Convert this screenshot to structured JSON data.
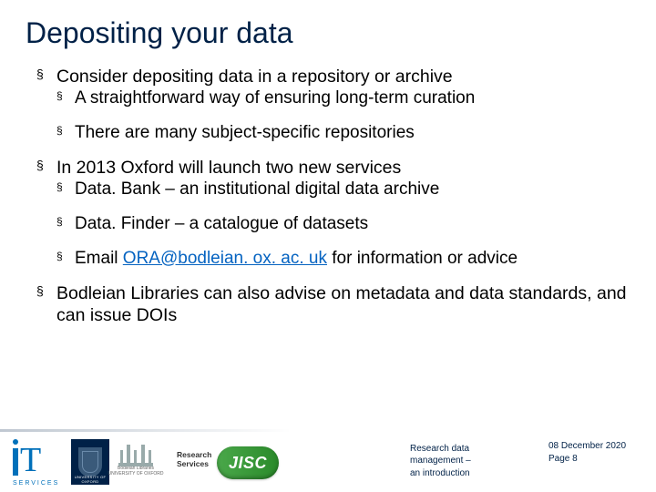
{
  "title": "Depositing your data",
  "content": {
    "items": [
      {
        "text": "Consider depositing data in a repository or archive",
        "subitems": [
          "A straightforward way of ensuring long-term curation",
          "There are many subject-specific repositories"
        ]
      },
      {
        "text": "In 2013 Oxford will launch two new services",
        "subitems": [
          "Data. Bank – an institutional digital data archive",
          "Data. Finder – a catalogue of datasets"
        ],
        "email_item": {
          "prefix": "Email ",
          "link_text": "ORA@bodleian. ox. ac. uk",
          "suffix": " for information or advice"
        }
      },
      {
        "text": "Bodleian Libraries can also advise on metadata and data standards, and can issue DOIs"
      }
    ]
  },
  "footer": {
    "research_services_line1": "Research",
    "research_services_line2": "Services",
    "jisc_label": "JISC",
    "bodleian_label1": "Bodleian Libraries",
    "bodleian_label2": "UNIVERSITY OF OXFORD",
    "oxford_label": "UNIVERSITY OF OXFORD",
    "meta_line1": "Research data",
    "meta_line2": "management –",
    "meta_line3": "an introduction",
    "date": "08 December 2020",
    "page": "Page 8"
  }
}
